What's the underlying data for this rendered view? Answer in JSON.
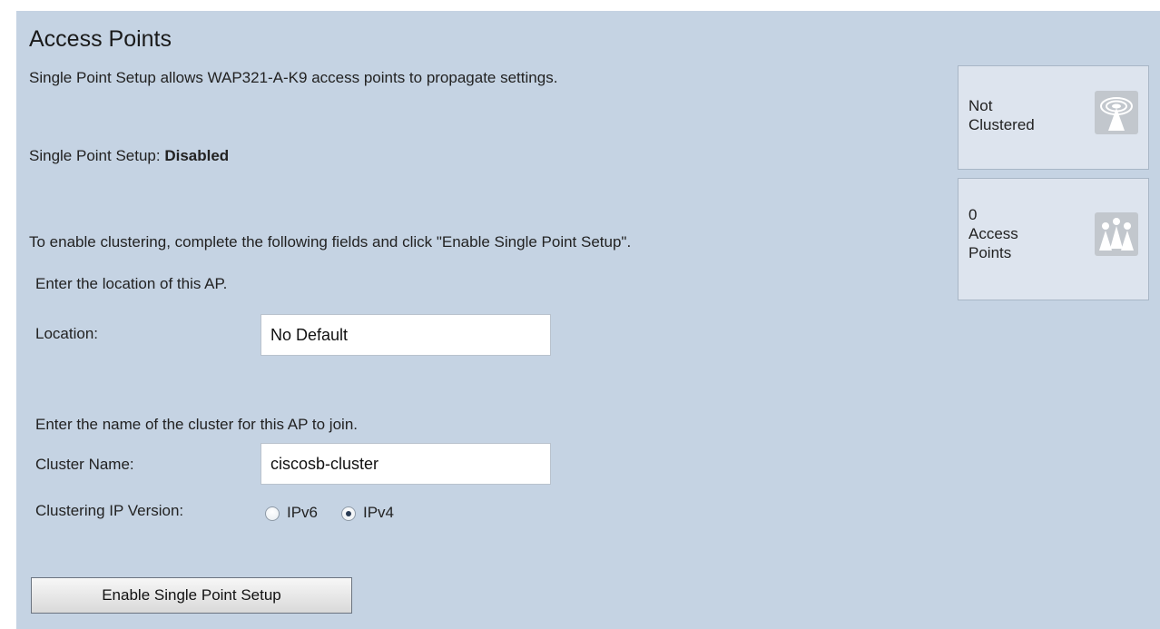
{
  "header": {
    "title": "Access Points"
  },
  "intro": {
    "description": "Single Point Setup allows WAP321-A-K9 access points to propagate settings.",
    "status_label": "Single Point Setup: ",
    "status_value": "Disabled",
    "instructions": "To enable clustering, complete the following fields and click \"Enable Single Point Setup\"."
  },
  "location": {
    "prompt": "Enter the location of this AP.",
    "label": "Location:",
    "value": "No Default"
  },
  "cluster": {
    "prompt": "Enter the name of the cluster for this AP to join.",
    "label": "Cluster Name:",
    "value": "ciscosb-cluster"
  },
  "ip_version": {
    "label": "Clustering IP Version:",
    "options": [
      {
        "label": "IPv6",
        "selected": false
      },
      {
        "label": "IPv4",
        "selected": true
      }
    ]
  },
  "actions": {
    "enable_label": "Enable Single Point Setup"
  },
  "status_boxes": [
    {
      "text_line1": "Not",
      "text_line2": "Clustered",
      "icon": "wireless-antenna-icon"
    },
    {
      "count": "0",
      "text_line1": "Access",
      "text_line2": "Points",
      "icon": "users-icon"
    }
  ]
}
